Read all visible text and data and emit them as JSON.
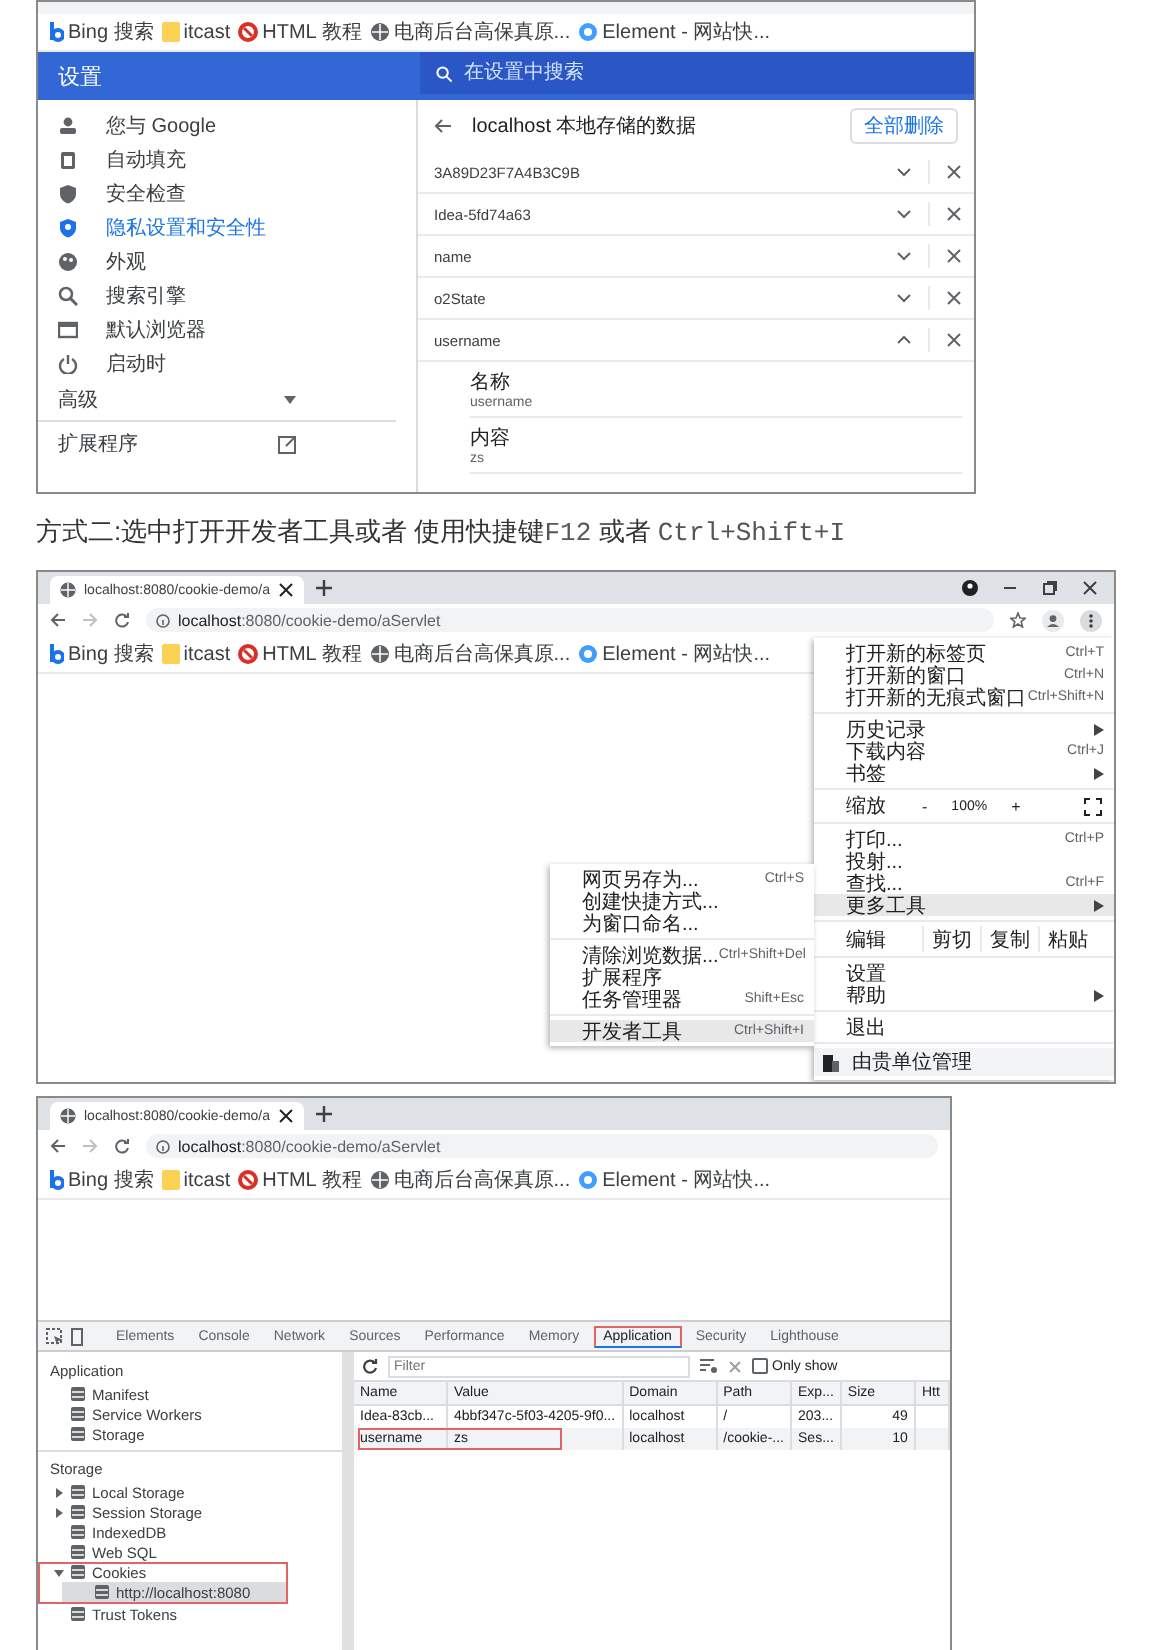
{
  "shot1": {
    "bookmarks": [
      "Bing 搜索",
      "itcast",
      "HTML 教程",
      "电商后台高保真原...",
      "Element - 网站快..."
    ],
    "header_title": "设置",
    "search_placeholder": "在设置中搜索",
    "sidebar": [
      {
        "label": "您与 Google",
        "selected": false
      },
      {
        "label": "自动填充",
        "selected": false
      },
      {
        "label": "安全检查",
        "selected": false
      },
      {
        "label": "隐私设置和安全性",
        "selected": true
      },
      {
        "label": "外观",
        "selected": false
      },
      {
        "label": "搜索引擎",
        "selected": false
      },
      {
        "label": "默认浏览器",
        "selected": false
      },
      {
        "label": "启动时",
        "selected": false
      }
    ],
    "advanced": "高级",
    "extensions": "扩展程序",
    "page_title": "localhost 本地存储的数据",
    "delete_all": "全部删除",
    "cookies": [
      {
        "name": "3A89D23F7A4B3C9B",
        "expanded": false
      },
      {
        "name": "Idea-5fd74a63",
        "expanded": false
      },
      {
        "name": "name",
        "expanded": false
      },
      {
        "name": "o2State",
        "expanded": false
      },
      {
        "name": "username",
        "expanded": true,
        "details": [
          {
            "label": "名称",
            "value": "username"
          },
          {
            "label": "内容",
            "value": "zs"
          }
        ]
      }
    ]
  },
  "caption": [
    {
      "kind": "text",
      "text": "方式二:选中打开开发者工具或者 使用快捷键"
    },
    {
      "kind": "code",
      "text": "F12"
    },
    {
      "kind": "text",
      "text": " 或者 "
    },
    {
      "kind": "code",
      "text": "Ctrl+Shift+I"
    }
  ],
  "shot2": {
    "tab_title": "localhost:8080/cookie-demo/a",
    "url": "**localhost**:8080/cookie-demo/aServlet",
    "bookmarks": [
      "Bing 搜索",
      "itcast",
      "HTML 教程",
      "电商后台高保真原...",
      "Element - 网站快..."
    ],
    "menu": [
      {
        "kind": "item",
        "label": "打开新的标签页",
        "shortcut": "Ctrl+T",
        "submenu": false,
        "selected": false
      },
      {
        "kind": "item",
        "label": "打开新的窗口",
        "shortcut": "Ctrl+N",
        "submenu": false,
        "selected": false
      },
      {
        "kind": "item",
        "label": "打开新的无痕式窗口",
        "shortcut": "Ctrl+Shift+N",
        "submenu": false,
        "selected": false
      },
      {
        "kind": "divider"
      },
      {
        "kind": "item",
        "label": "历史记录",
        "submenu": true,
        "selected": false
      },
      {
        "kind": "item",
        "label": "下载内容",
        "shortcut": "Ctrl+J",
        "submenu": false,
        "selected": false
      },
      {
        "kind": "item",
        "label": "书签",
        "submenu": true,
        "selected": false
      },
      {
        "kind": "divider"
      },
      {
        "kind": "zoom",
        "label": "缩放",
        "minus": "-",
        "value": "100%",
        "plus": "+"
      },
      {
        "kind": "divider"
      },
      {
        "kind": "item",
        "label": "打印...",
        "shortcut": "Ctrl+P",
        "submenu": false,
        "selected": false
      },
      {
        "kind": "item",
        "label": "投射...",
        "submenu": false,
        "selected": false
      },
      {
        "kind": "item",
        "label": "查找...",
        "shortcut": "Ctrl+F",
        "submenu": false,
        "selected": false
      },
      {
        "kind": "item",
        "label": "更多工具",
        "submenu": true,
        "selected": true
      },
      {
        "kind": "divider"
      },
      {
        "kind": "edit",
        "label": "编辑",
        "actions": [
          "剪切",
          "复制",
          "粘贴"
        ]
      },
      {
        "kind": "divider"
      },
      {
        "kind": "item",
        "label": "设置",
        "submenu": false,
        "selected": false
      },
      {
        "kind": "item",
        "label": "帮助",
        "submenu": true,
        "selected": false
      },
      {
        "kind": "divider"
      },
      {
        "kind": "item",
        "label": "退出",
        "submenu": false,
        "selected": false
      },
      {
        "kind": "divider"
      },
      {
        "kind": "managed",
        "label": "由贵单位管理"
      }
    ],
    "submenu": [
      {
        "kind": "item",
        "label": "网页另存为...",
        "shortcut": "Ctrl+S",
        "selected": false
      },
      {
        "kind": "item",
        "label": "创建快捷方式...",
        "selected": false
      },
      {
        "kind": "item",
        "label": "为窗口命名...",
        "selected": false
      },
      {
        "kind": "divider"
      },
      {
        "kind": "item",
        "label": "清除浏览数据...",
        "shortcut": "Ctrl+Shift+Del",
        "selected": false
      },
      {
        "kind": "item",
        "label": "扩展程序",
        "selected": false
      },
      {
        "kind": "item",
        "label": "任务管理器",
        "shortcut": "Shift+Esc",
        "selected": false
      },
      {
        "kind": "divider"
      },
      {
        "kind": "item",
        "label": "开发者工具",
        "shortcut": "Ctrl+Shift+I",
        "selected": true
      }
    ]
  },
  "shot3": {
    "tab_title": "localhost:8080/cookie-demo/a",
    "url": "**localhost**:8080/cookie-demo/aServlet",
    "bookmarks": [
      "Bing 搜索",
      "itcast",
      "HTML 教程",
      "电商后台高保真原...",
      "Element - 网站快..."
    ],
    "devtools": {
      "tabs": [
        {
          "label": "Elements",
          "selected": false,
          "annotated": false
        },
        {
          "label": "Console",
          "selected": false,
          "annotated": false
        },
        {
          "label": "Network",
          "selected": false,
          "annotated": false
        },
        {
          "label": "Sources",
          "selected": false,
          "annotated": false
        },
        {
          "label": "Performance",
          "selected": false,
          "annotated": false
        },
        {
          "label": "Memory",
          "selected": false,
          "annotated": false
        },
        {
          "label": "Application",
          "selected": true,
          "annotated": true
        },
        {
          "label": "Security",
          "selected": false,
          "annotated": false
        },
        {
          "label": "Lighthouse",
          "selected": false,
          "annotated": false
        }
      ],
      "sections": [
        {
          "title": "Application",
          "items": [
            {
              "label": "Manifest",
              "selected": false,
              "annotated": false
            },
            {
              "label": "Service Workers",
              "selected": false,
              "annotated": false
            },
            {
              "label": "Storage",
              "selected": false,
              "annotated": false
            }
          ]
        },
        {
          "title": "Storage",
          "items": [
            {
              "label": "Local Storage",
              "expanded": false,
              "selected": false,
              "annotated": false
            },
            {
              "label": "Session Storage",
              "expanded": false,
              "selected": false,
              "annotated": false
            },
            {
              "label": "IndexedDB",
              "selected": false,
              "annotated": false
            },
            {
              "label": "Web SQL",
              "selected": false,
              "annotated": false
            },
            {
              "label": "Cookies",
              "expanded": true,
              "selected": false,
              "annotated": true,
              "children": [
                {
                  "label": "http://localhost:8080",
                  "selected": true,
                  "annotated": false
                }
              ]
            },
            {
              "label": "Trust Tokens",
              "selected": false,
              "annotated": false
            }
          ]
        }
      ],
      "filter_placeholder": "Filter",
      "only_show": {
        "label": "Only show",
        "checked": false
      },
      "columns": [
        "Name",
        "Value",
        "Domain",
        "Path",
        "Exp...",
        "Size",
        "Htt"
      ],
      "rows": [
        {
          "cells": [
            "Idea-83cb...",
            "4bbf347c-5f03-4205-9f0...",
            "localhost",
            "/",
            "203...",
            "49",
            ""
          ],
          "selected": false,
          "annotated": false
        },
        {
          "cells": [
            "username",
            "zs",
            "localhost",
            "/cookie-...",
            "Ses...",
            "10",
            ""
          ],
          "selected": true,
          "annotated": true
        }
      ]
    }
  }
}
